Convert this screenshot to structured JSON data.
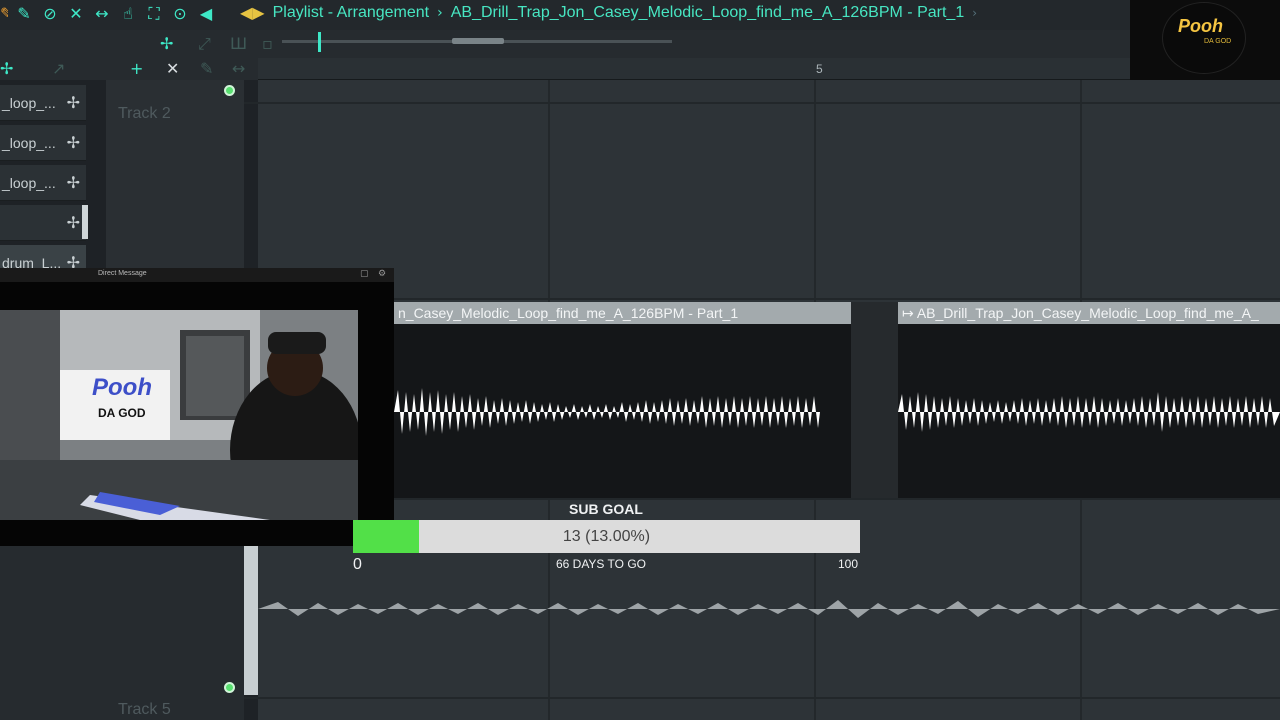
{
  "toolbar": {
    "icons": [
      "brush-icon",
      "mute-icon",
      "detune-icon",
      "volume-icon",
      "stretch-icon",
      "select-icon",
      "zoom-icon",
      "playback-icon"
    ],
    "icon_glyphs": [
      "✎",
      "⊘",
      "✕",
      "↔",
      "☝",
      "⛶",
      "🔍",
      "◀"
    ],
    "window_title": "Playlist - Arrangement",
    "current_pattern": "AB_Drill_Trap_Jon_Casey_Melodic_Loop_find_me_A_126BPM - Part_1"
  },
  "ruler": {
    "bar_label": "5"
  },
  "channels": [
    {
      "label": "_loop_..."
    },
    {
      "label": "_loop_..."
    },
    {
      "label": "_loop_..."
    },
    {
      "label": ""
    },
    {
      "label": "drum_L..."
    }
  ],
  "tracks": {
    "track_2": "Track 2",
    "track_5": "Track 5"
  },
  "clips": [
    {
      "title": "n_Casey_Melodic_Loop_find_me_A_126BPM - Part_1"
    },
    {
      "title": "↦ AB_Drill_Trap_Jon_Casey_Melodic_Loop_find_me_A_"
    }
  ],
  "logo": {
    "text": "Pooh",
    "sub": "DA GOD"
  },
  "webcam": {
    "window_title": "Direct Message",
    "overlay_logo": "Pooh",
    "overlay_sub": "DA GOD"
  },
  "sub_goal": {
    "title": "SUB GOAL",
    "label": "13 (13.00%)",
    "current": 13,
    "min": "0",
    "max": "100",
    "days_left": "66 DAYS TO GO",
    "fill_color": "#52e048"
  },
  "colors": {
    "accent": "#3ee8c7",
    "title": "#47e6c2",
    "clip_header": "#a3aaad"
  }
}
